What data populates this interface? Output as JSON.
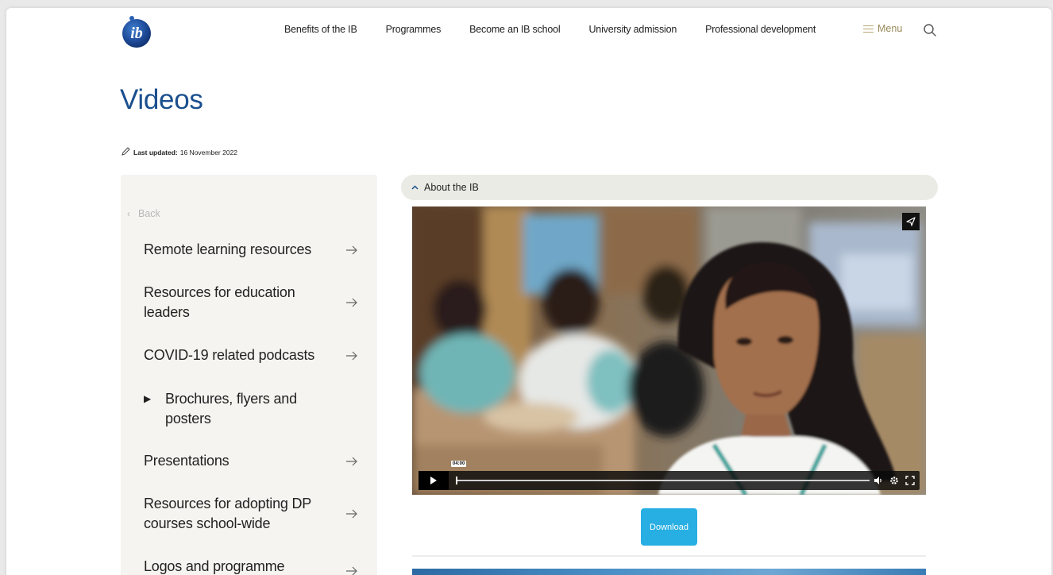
{
  "header": {
    "logo_text": "ib",
    "nav": [
      "Benefits of the IB",
      "Programmes",
      "Become an IB school",
      "University admission",
      "Professional development"
    ],
    "menu_label": "Menu"
  },
  "page": {
    "title": "Videos",
    "last_updated_label": "Last updated:",
    "last_updated_date": "16 November 2022"
  },
  "sidebar": {
    "back_label": "Back",
    "items": [
      {
        "label": "Remote learning resources"
      },
      {
        "label": "Resources for education leaders"
      },
      {
        "label": "COVID-19 related podcasts"
      },
      {
        "label": "Brochures, flyers and posters"
      },
      {
        "label": "Presentations"
      },
      {
        "label": "Resources for adopting DP courses school-wide"
      },
      {
        "label": "Logos and programme"
      }
    ]
  },
  "main": {
    "accordion_label": "About the IB",
    "video": {
      "time": "04:00",
      "progress": 0
    },
    "download_label": "Download"
  },
  "colors": {
    "title_blue": "#1a4f8e",
    "accent_gold": "#9a8a5a",
    "download_blue": "#27aee3",
    "sidebar_bg": "#f5f4f1",
    "accordion_bg": "#ebebe6"
  }
}
